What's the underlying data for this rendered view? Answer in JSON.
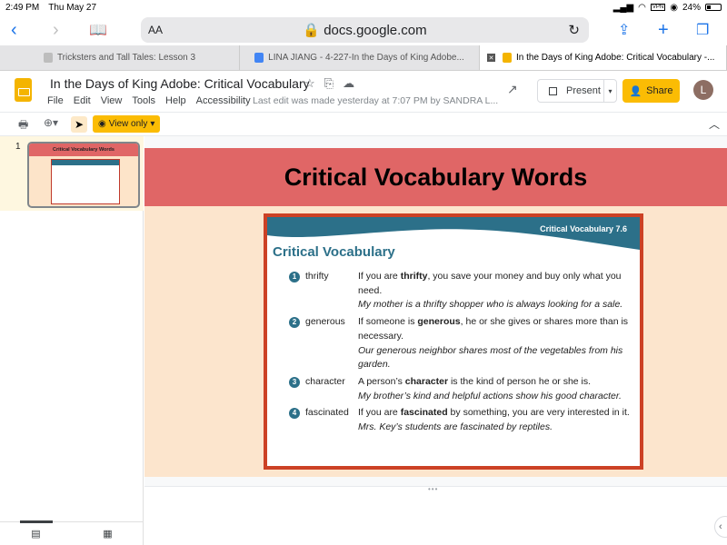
{
  "status_bar": {
    "time": "2:49 PM",
    "date": "Thu May 27",
    "vpn": "VPN",
    "battery": "24%",
    "battery_level": 0.24
  },
  "browser": {
    "text_size_label": "AA",
    "url": "docs.google.com",
    "tabs": [
      {
        "title": "Tricksters and Tall Tales: Lesson 3",
        "icon": "google-classroom-icon",
        "color": "#bdbdbd"
      },
      {
        "title": "LINA JIANG - 4-227-In the Days of King Adobe...",
        "icon": "google-docs-icon",
        "color": "#4285f4"
      },
      {
        "title": "In the Days of King Adobe: Critical Vocabulary -...",
        "icon": "google-slides-icon",
        "color": "#f4b400",
        "active": true
      }
    ]
  },
  "app": {
    "title": "In the Days of King Adobe: Critical Vocabulary",
    "menu": [
      "File",
      "Edit",
      "View",
      "Tools",
      "Help",
      "Accessibility"
    ],
    "last_edit": "Last edit was made yesterday at 7:07 PM by SANDRA L...",
    "present_label": "Present",
    "share_label": "Share",
    "avatar_initial": "L",
    "view_only_label": "View only"
  },
  "filmstrip": {
    "slides": [
      {
        "number": "1",
        "title": "Critical Vocabulary Words"
      }
    ]
  },
  "slide": {
    "heading": "Critical Vocabulary Words",
    "card": {
      "tag": "Critical Vocabulary 7.6",
      "title": "Critical Vocabulary",
      "entries": [
        {
          "n": "1",
          "word": "thrifty",
          "def_pre": "If you are ",
          "def_bold": "thrifty",
          "def_post": ", you save your money and buy only what you need.",
          "example": "My mother is a thrifty shopper who is always looking for a sale."
        },
        {
          "n": "2",
          "word": "generous",
          "def_pre": "If someone is ",
          "def_bold": "generous",
          "def_post": ", he or she gives or shares more than is necessary.",
          "example": "Our generous neighbor shares most of the vegetables from his garden."
        },
        {
          "n": "3",
          "word": "character",
          "def_pre": "A person’s ",
          "def_bold": "character",
          "def_post": " is the kind of person he or she is.",
          "example": "My brother’s kind and helpful actions show his good character."
        },
        {
          "n": "4",
          "word": "fascinated",
          "def_pre": "If you are ",
          "def_bold": "fascinated",
          "def_post": " by something, you are very interested in it.",
          "example": "Mrs. Key’s students are fascinated by reptiles."
        }
      ]
    }
  },
  "colors": {
    "share": "#fbbc04",
    "slide_header": "#e06666",
    "slide_bg": "#fce5cd",
    "card_border": "#cc4125",
    "teal": "#2c7089"
  }
}
